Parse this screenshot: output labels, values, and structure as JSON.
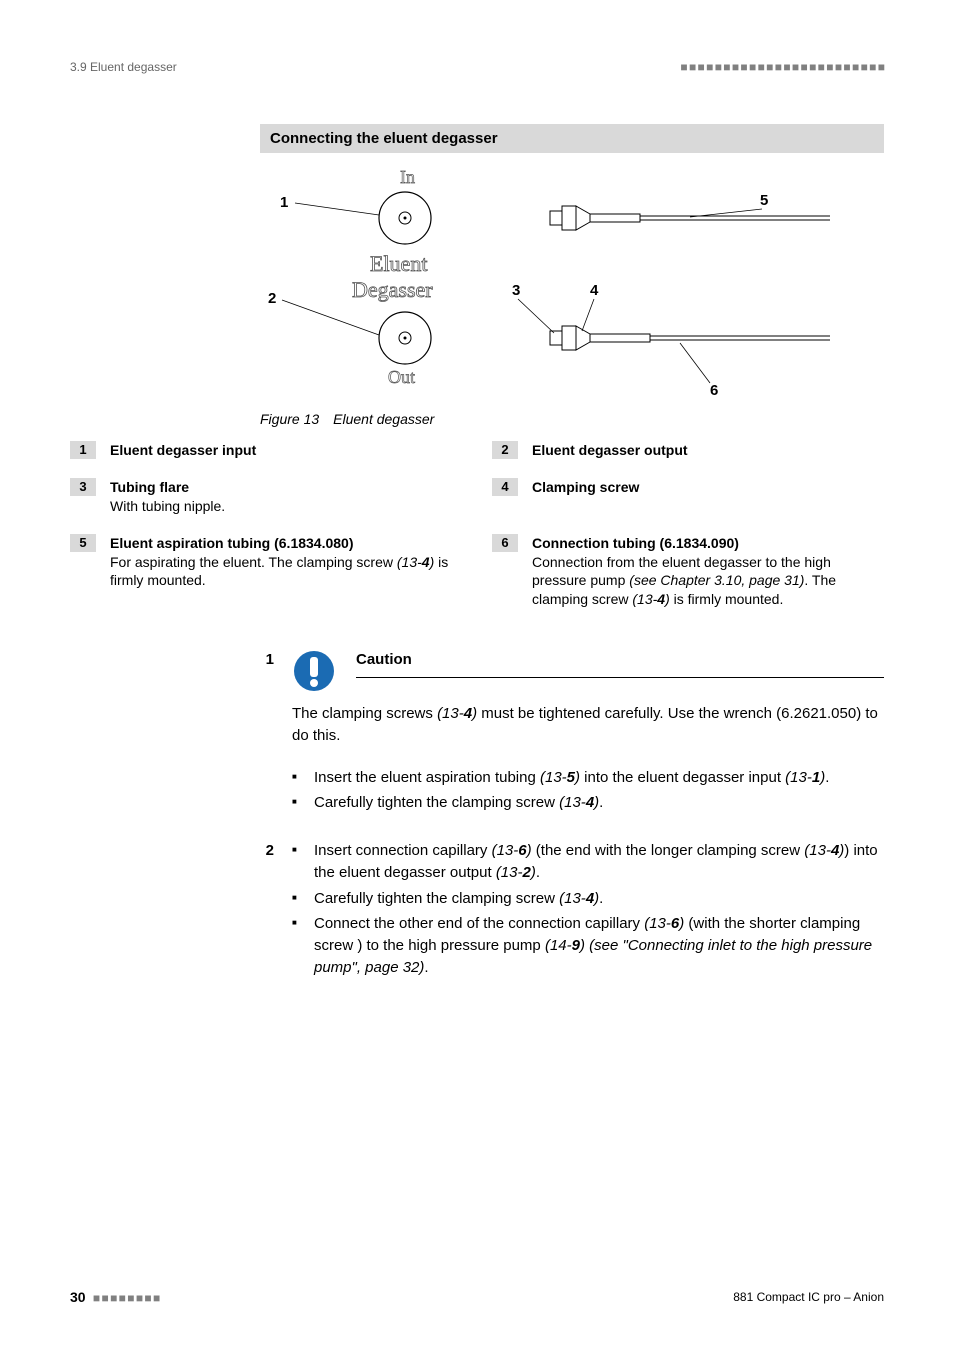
{
  "header": {
    "section": "3.9 Eluent degasser",
    "decor": "■ ■ ■ ■ ■ ■ ■ ■ ■ ■ ■ ■ ■ ■ ■ ■ ■ ■ ■ ■ ■ ■ ■ ■"
  },
  "section_bar": "Connecting the eluent degasser",
  "figure": {
    "label_top": "In",
    "label_mid1": "Eluent",
    "label_mid2": "Degasser",
    "label_bottom": "Out",
    "callout_1": "1",
    "callout_2": "2",
    "callout_3": "3",
    "callout_4": "4",
    "callout_5": "5",
    "callout_6": "6",
    "caption": "Figure 13 Eluent degasser"
  },
  "legend": {
    "i1": {
      "num": "1",
      "title": "Eluent degasser input"
    },
    "i2": {
      "num": "2",
      "title": "Eluent degasser output"
    },
    "i3": {
      "num": "3",
      "title": "Tubing flare",
      "desc": "With tubing nipple."
    },
    "i4": {
      "num": "4",
      "title": "Clamping screw"
    },
    "i5": {
      "num": "5",
      "title": "Eluent aspiration tubing (6.1834.080)",
      "desc_a": "For aspirating the eluent. The clamping screw ",
      "desc_ref": "(13-",
      "desc_refb": "4",
      "desc_refc": ")",
      "desc_b": " is firmly mounted."
    },
    "i6": {
      "num": "6",
      "title": "Connection tubing (6.1834.090)",
      "desc_a": "Connection from the eluent degasser to the high pressure pump ",
      "desc_b": "(see Chapter 3.10, page 31)",
      "desc_c": ". The clamping screw ",
      "desc_ref": "(13-",
      "desc_refb": "4",
      "desc_refc": ")",
      "desc_d": " is firmly mounted."
    }
  },
  "steps": {
    "s1": {
      "num": "1",
      "caution_label": "Caution",
      "caution_a": "The clamping screws ",
      "caution_ref": "(13-",
      "caution_refb": "4",
      "caution_refc": ")",
      "caution_b": " must be tightened carefully. Use the wrench (6.2621.050) to do this.",
      "b1a": "Insert the eluent aspiration tubing ",
      "b1r1": "(13-",
      "b1rb1": "5",
      "b1rc1": ")",
      "b1b": " into the eluent degasser input ",
      "b1r2": "(13-",
      "b1rb2": "1",
      "b1rc2": ")",
      "b1c": ".",
      "b2a": "Carefully tighten the clamping screw ",
      "b2r": "(13-",
      "b2rb": "4",
      "b2rc": ")",
      "b2b": "."
    },
    "s2": {
      "num": "2",
      "b1a": "Insert connection capillary ",
      "b1r1": "(13-",
      "b1rb1": "6",
      "b1rc1": ")",
      "b1b": " (the end with the longer clamping screw ",
      "b1r2": "(13-",
      "b1rb2": "4",
      "b1rc2": ")",
      "b1c": ") into the eluent degasser output ",
      "b1r3": "(13-",
      "b1rb3": "2",
      "b1rc3": ")",
      "b1d": ".",
      "b2a": "Carefully tighten the clamping screw ",
      "b2r": "(13-",
      "b2rb": "4",
      "b2rc": ")",
      "b2b": ".",
      "b3a": "Connect the other end of the connection capillary ",
      "b3r1": "(13-",
      "b3rb1": "6",
      "b3rc1": ")",
      "b3b": " (with the shorter clamping screw ) to the high pressure pump ",
      "b3r2": "(14-",
      "b3rb2": "9",
      "b3rc2": ")",
      "b3c": " ",
      "b3d": "(see \"Connecting inlet to the high pressure pump\", page 32)",
      "b3e": "."
    }
  },
  "footer": {
    "page": "30",
    "decor": "■ ■ ■ ■ ■ ■ ■ ■",
    "doc": "881 Compact IC pro – Anion"
  }
}
